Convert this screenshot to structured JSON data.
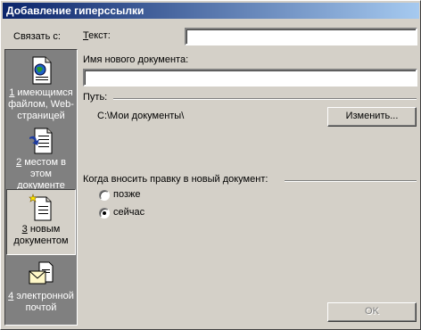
{
  "window": {
    "title": "Добавление гиперссылки"
  },
  "sidebar": {
    "heading": "Связать с:",
    "items": [
      {
        "key": "1",
        "rest": " имеющимся файлом, Web-страницей",
        "icon": "web-page-icon",
        "selected": false
      },
      {
        "key": "2",
        "rest": " местом в этом документе",
        "icon": "document-place-icon",
        "selected": false
      },
      {
        "key": "3",
        "rest": " новым документом",
        "icon": "new-document-icon",
        "selected": true
      },
      {
        "key": "4",
        "rest": " электронной почтой",
        "icon": "email-envelope-icon",
        "selected": false
      }
    ]
  },
  "form": {
    "text_label": "Текст:",
    "text_value": "",
    "new_doc_label": "Имя нового документа:",
    "new_doc_value": "",
    "path_label": "Путь:",
    "path_value": "C:\\Мои документы\\",
    "change_button": "Изменить...",
    "when_edit_label": "Когда вносить правку в новый документ:",
    "radio_later": "позже",
    "radio_now": "сейчас",
    "selected_radio": "now",
    "ok_button": "OK"
  },
  "colors": {
    "title_start": "#0a246a",
    "title_end": "#a6caf0",
    "face": "#d4d0c8",
    "sidebar": "#808080"
  }
}
